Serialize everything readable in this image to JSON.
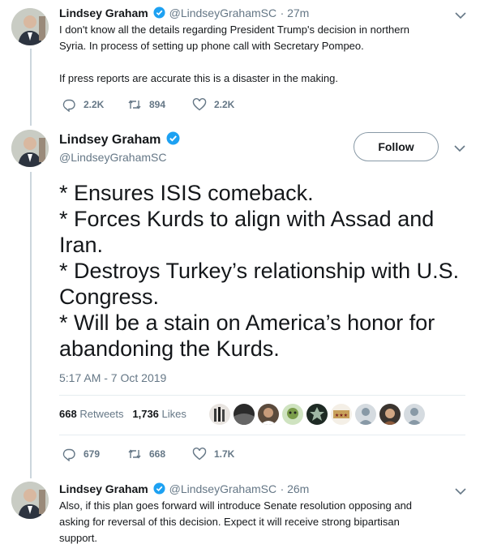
{
  "tweet1": {
    "name": "Lindsey Graham",
    "handle": "@LindseyGrahamSC",
    "time": "· 27m",
    "line1": "I don't know all the details regarding President Trump's decision in northern",
    "line2": "Syria. In process  of setting up phone call with Secretary Pompeo.",
    "line3": "If press reports are accurate this is a disaster in the making.",
    "replies": "2.2K",
    "retweets": "894",
    "likes": "2.2K"
  },
  "main_tweet": {
    "name": "Lindsey Graham",
    "handle": "@LindseyGrahamSC",
    "follow_label": "Follow",
    "lines": [
      "* Ensures ISIS comeback.",
      "* Forces Kurds to align with Assad and",
      "Iran.",
      "* Destroys Turkey’s relationship with U.S.",
      "Congress.",
      "* Will be a stain on America’s honor for",
      "abandoning the Kurds."
    ],
    "timestamp": "5:17 AM - 7 Oct 2019",
    "retweet_count": "668",
    "retweet_label": "Retweets",
    "like_count": "1,736",
    "like_label": "Likes",
    "replies": "679",
    "retweets": "668",
    "likes": "1.7K"
  },
  "tweet3": {
    "name": "Lindsey Graham",
    "handle": "@LindseyGrahamSC",
    "time": "· 26m",
    "line1": "Also, if this plan goes forward will introduce Senate resolution opposing and",
    "line2": "asking for reversal of this decision.  Expect it will receive strong bipartisan",
    "line3": "support."
  },
  "colors": {
    "verified": "#1da1f2",
    "secondary_text": "#657786",
    "thread_line": "#ccd6dd"
  },
  "icons": [
    "verified-badge-icon",
    "chevron-down-icon",
    "reply-icon",
    "retweet-icon",
    "heart-icon"
  ]
}
